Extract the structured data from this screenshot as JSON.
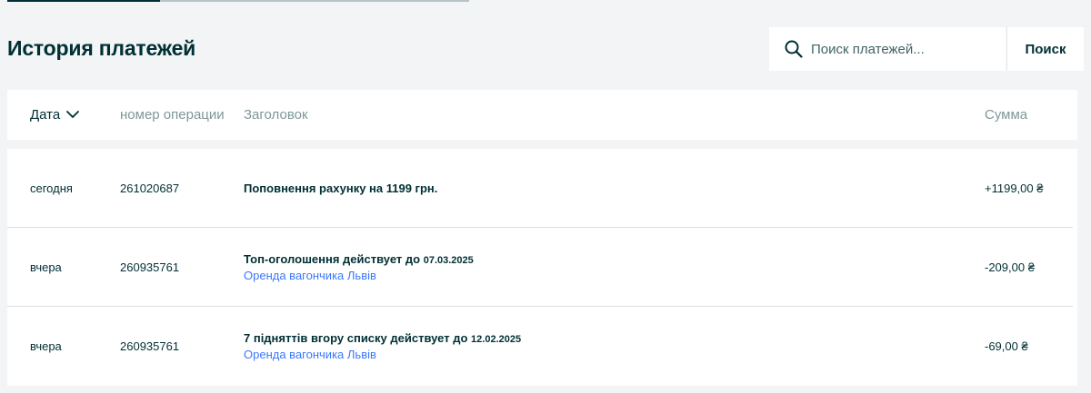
{
  "page": {
    "title": "История платежей"
  },
  "search": {
    "placeholder": "Поиск платежей...",
    "button_label": "Поиск"
  },
  "table": {
    "columns": {
      "date": "Дата",
      "operation_number": "номер операции",
      "title": "Заголовок",
      "amount": "Сумма"
    },
    "rows": [
      {
        "date": "сегодня",
        "operation_number": "261020687",
        "title": "Поповнення рахунку на 1199 грн.",
        "title_date": "",
        "link": "",
        "amount": "+1199,00 ₴"
      },
      {
        "date": "вчера",
        "operation_number": "260935761",
        "title": "Топ-оголошення действует до",
        "title_date": "07.03.2025",
        "link": "Оренда вагончика Львів",
        "amount": "-209,00 ₴"
      },
      {
        "date": "вчера",
        "operation_number": "260935761",
        "title": "7 підняттів вгору списку действует до",
        "title_date": "12.02.2025",
        "link": "Оренда вагончика Львів",
        "amount": "-69,00 ₴"
      }
    ]
  },
  "colors": {
    "background": "#f2f4f5",
    "text_primary": "#002f34",
    "text_muted": "#7f9799",
    "link": "#3a77ff"
  },
  "icons": {
    "search": "search-icon",
    "sort": "chevron-down-icon"
  }
}
